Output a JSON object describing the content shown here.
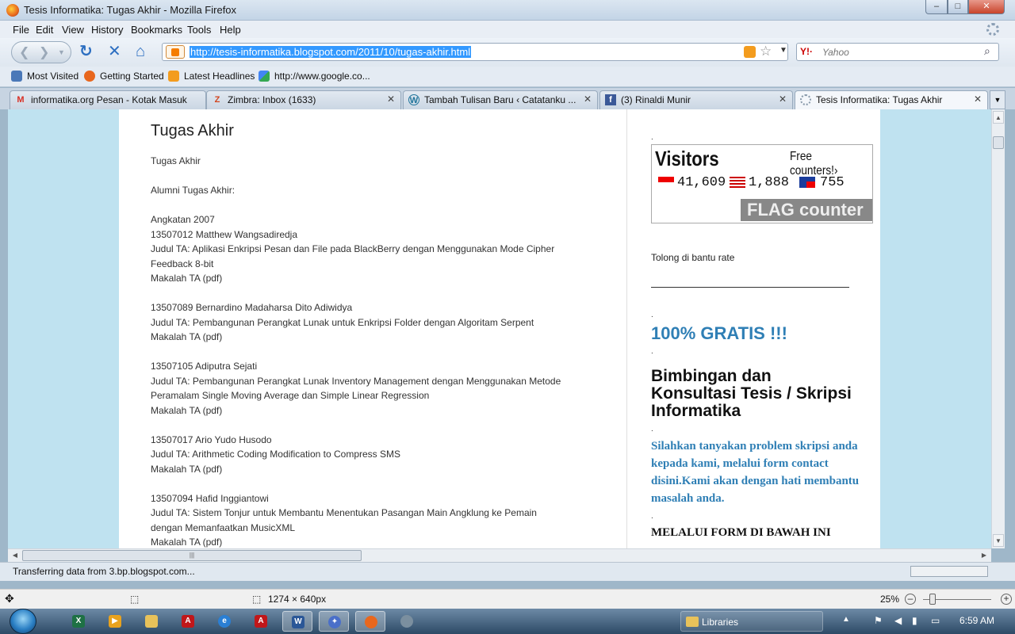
{
  "window": {
    "title": "Tesis Informatika: Tugas Akhir - Mozilla Firefox",
    "min": "–",
    "max": "□",
    "close": "✕"
  },
  "menu": [
    "File",
    "Edit",
    "View",
    "History",
    "Bookmarks",
    "Tools",
    "Help"
  ],
  "nav": {
    "url": "http://tesis-informatika.blogspot.com/2011/10/tugas-akhir.html",
    "search_placeholder": "Yahoo",
    "search_engine": "Y!·"
  },
  "bookmarks": [
    "Most Visited",
    "Getting Started",
    "Latest Headlines",
    "http://www.google.co..."
  ],
  "tabs": [
    {
      "label": "informatika.org Pesan - Kotak Masuk",
      "icon": "M",
      "color": "#d93025"
    },
    {
      "label": "Zimbra: Inbox (1633)",
      "icon": "Z",
      "color": "#d2451e"
    },
    {
      "label": "Tambah Tulisan Baru ‹ Catatanku ...",
      "icon": "W",
      "color": "#21759b"
    },
    {
      "label": "(3) Rinaldi Munir",
      "icon": "f",
      "color": "#3b5998"
    },
    {
      "label": "Tesis Informatika: Tugas Akhir",
      "icon": "",
      "color": "#8899aa"
    }
  ],
  "post": {
    "title": "Tugas Akhir",
    "lines": [
      "Tugas Akhir",
      "",
      "Alumni Tugas Akhir:",
      "",
      "Angkatan 2007",
      "13507012 Matthew Wangsadiredja",
      "Judul TA: Aplikasi Enkripsi Pesan dan File pada BlackBerry dengan Menggunakan Mode Cipher",
      "Feedback 8-bit",
      "Makalah TA (pdf)",
      "",
      "13507089 Bernardino Madaharsa Dito Adiwidya",
      "Judul TA: Pembangunan Perangkat Lunak untuk Enkripsi Folder dengan Algoritam Serpent",
      "Makalah TA (pdf)",
      "",
      "13507105 Adiputra Sejati",
      "Judul TA: Pembangunan Perangkat Lunak Inventory Management dengan Menggunakan Metode",
      "Peramalam Single Moving Average dan Simple Linear Regression",
      "Makalah TA (pdf)",
      "",
      "13507017 Ario Yudo Husodo",
      "Judul TA: Arithmetic Coding Modification to Compress SMS",
      "Makalah TA (pdf)",
      "",
      "13507094 Hafid Inggiantowi",
      "Judul TA: Sistem Tonjur untuk Membantu Menentukan Pasangan Main Angklung ke Pemain",
      "dengan Memanfaatkan MusicXML",
      "Makalah TA (pdf)"
    ]
  },
  "sidebar": {
    "counter": {
      "visitors": "Visitors",
      "free": "Free counters!›",
      "counts": [
        "41,609",
        "1,888",
        "755"
      ],
      "brand": "FLAG counter"
    },
    "rate": "Tolong di bantu rate",
    "gratis": "100% GRATIS !!!",
    "bimbingan": "Bimbingan dan Konsultasi Tesis / Skripsi Informatika",
    "silahkan": "Silahkan tanyakan problem skripsi anda kepada kami, melalui form contact disini.Kami akan dengan hati membantu masalah anda.",
    "melalui": "MELALUI FORM DI BAWAH INI",
    "dot": "."
  },
  "status": {
    "message": "Transferring data from 3.bp.blogspot.com..."
  },
  "zoombar": {
    "dimensions": "1274 × 640px",
    "zoom": "25%"
  },
  "taskbar": {
    "libraries": "Libraries",
    "time": "6:59 AM"
  }
}
